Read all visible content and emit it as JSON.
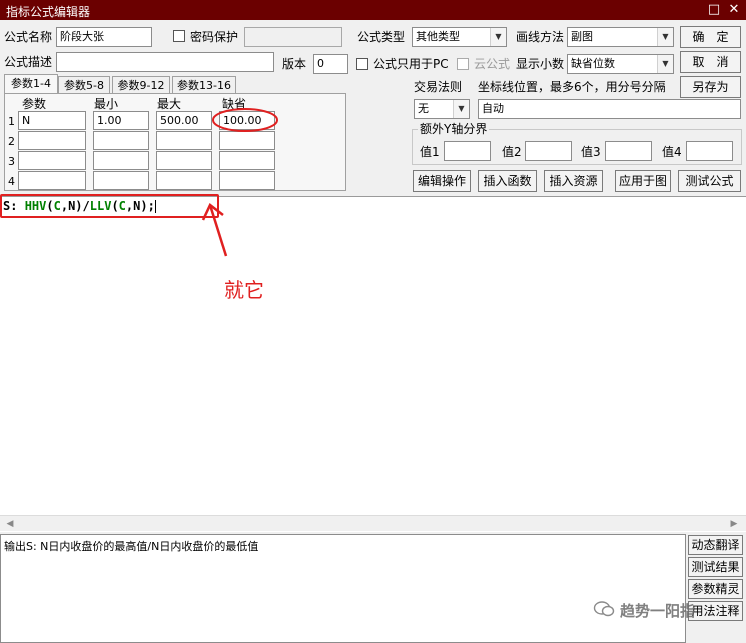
{
  "window": {
    "title": "指标公式编辑器",
    "max_glyph": "□",
    "close_glyph": "✕"
  },
  "form": {
    "name_label": "公式名称",
    "name_value": "阶段大张",
    "password_label": "密码保护",
    "desc_label": "公式描述",
    "version_label": "版本",
    "version_value": "0",
    "type_label": "公式类型",
    "type_value": "其他类型",
    "draw_label": "画线方法",
    "draw_value": "副图",
    "pc_only_label": "公式只用于PC",
    "cloud_label": "云公式",
    "decimals_label": "显示小数",
    "decimals_value": "缺省位数",
    "trade_rule_label": "交易法则",
    "trade_rule_value": "无",
    "coord_label": "坐标线位置，最多6个，用分号分隔",
    "coord_value": "自动",
    "extra_y_label": "额外Y轴分界",
    "value_labels": [
      "值1",
      "值2",
      "值3",
      "值4"
    ]
  },
  "tabs": [
    "参数1-4",
    "参数5-8",
    "参数9-12",
    "参数13-16"
  ],
  "params": {
    "headers": [
      "参数",
      "最小",
      "最大",
      "缺省"
    ],
    "rows": [
      {
        "idx": "1",
        "name": "N",
        "min": "1.00",
        "max": "500.00",
        "default": "100.00"
      },
      {
        "idx": "2",
        "name": "",
        "min": "",
        "max": "",
        "default": ""
      },
      {
        "idx": "3",
        "name": "",
        "min": "",
        "max": "",
        "default": ""
      },
      {
        "idx": "4",
        "name": "",
        "min": "",
        "max": "",
        "default": ""
      }
    ]
  },
  "buttons": {
    "ok": "确　定",
    "cancel": "取　消",
    "save_as": "另存为",
    "edit_ops": "编辑操作",
    "insert_func": "插入函数",
    "insert_res": "插入资源",
    "apply_chart": "应用于图",
    "test_formula": "测试公式"
  },
  "editor": {
    "code_prefix": "S: ",
    "code_parts": [
      "HHV",
      "(",
      "C",
      ",N)/",
      "LLV",
      "(",
      "C",
      ",N);"
    ],
    "annotation": "就它"
  },
  "output": {
    "text": "输出S: N日内收盘价的最高值/N日内收盘价的最低值"
  },
  "side_buttons": [
    "动态翻译",
    "测试结果",
    "参数精灵",
    "用法注释"
  ],
  "watermark": "趋势一阳指",
  "colors": {
    "title_bg": "#6b0000",
    "func": "#008000",
    "annotation": "#e02020"
  }
}
